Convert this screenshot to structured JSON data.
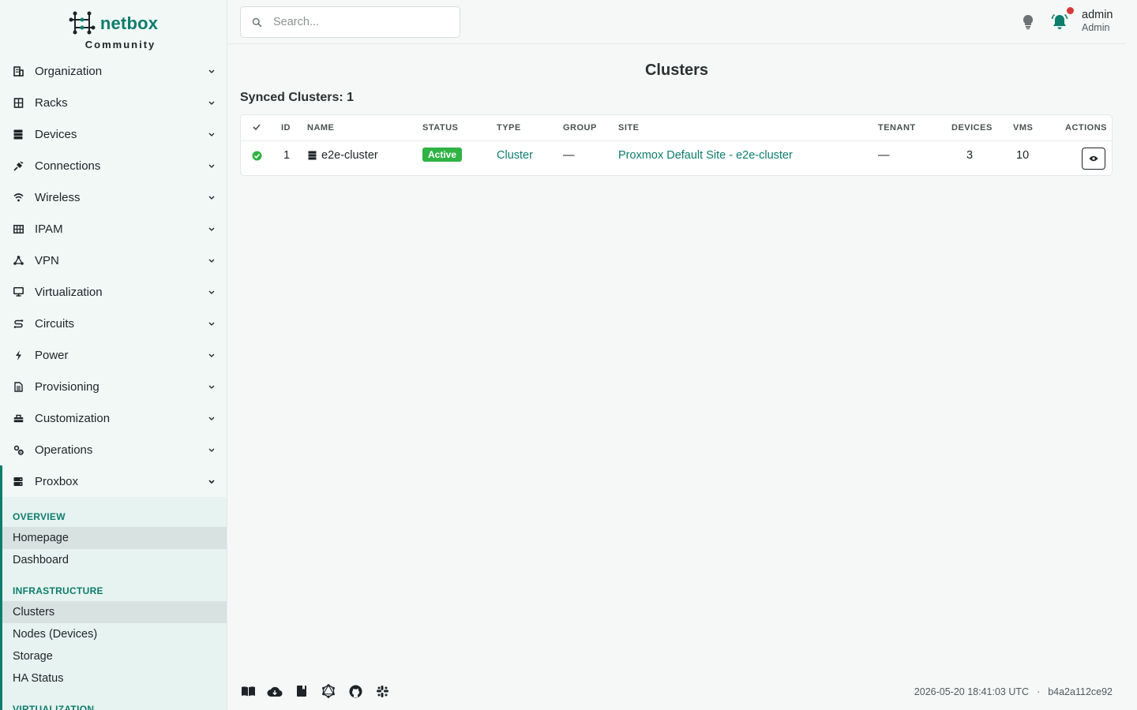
{
  "brand": {
    "name": "netbox",
    "edition": "Community"
  },
  "search": {
    "placeholder": "Search..."
  },
  "user": {
    "name": "admin",
    "role": "Admin"
  },
  "nav": [
    {
      "label": "Organization",
      "icon": "building-icon"
    },
    {
      "label": "Racks",
      "icon": "rack-icon"
    },
    {
      "label": "Devices",
      "icon": "server-icon"
    },
    {
      "label": "Connections",
      "icon": "plug-icon"
    },
    {
      "label": "Wireless",
      "icon": "wifi-icon"
    },
    {
      "label": "IPAM",
      "icon": "counter-icon"
    },
    {
      "label": "VPN",
      "icon": "network-icon"
    },
    {
      "label": "Virtualization",
      "icon": "monitor-icon"
    },
    {
      "label": "Circuits",
      "icon": "transit-icon"
    },
    {
      "label": "Power",
      "icon": "bolt-icon"
    },
    {
      "label": "Provisioning",
      "icon": "file-icon"
    },
    {
      "label": "Customization",
      "icon": "toolbox-icon"
    },
    {
      "label": "Operations",
      "icon": "cogs-icon"
    },
    {
      "label": "Proxbox",
      "icon": "server-icon"
    }
  ],
  "proxbox": {
    "overview_heading": "OVERVIEW",
    "overview_items": [
      "Homepage",
      "Dashboard"
    ],
    "infrastructure_heading": "INFRASTRUCTURE",
    "infrastructure_items": [
      "Clusters",
      "Nodes (Devices)",
      "Storage",
      "HA Status"
    ],
    "virtualization_heading": "VIRTUALIZATION"
  },
  "page": {
    "title": "Clusters",
    "section": "Synced Clusters: 1"
  },
  "table": {
    "headers": {
      "id": "ID",
      "name": "NAME",
      "status": "STATUS",
      "type": "TYPE",
      "group": "GROUP",
      "site": "SITE",
      "tenant": "TENANT",
      "devices": "DEVICES",
      "vms": "VMS",
      "actions": "ACTIONS"
    },
    "rows": [
      {
        "id": "1",
        "name": "e2e-cluster",
        "status": "Active",
        "type": "Cluster",
        "group": "—",
        "site": "Proxmox Default Site - e2e-cluster",
        "tenant": "—",
        "devices": "3",
        "vms": "10"
      }
    ]
  },
  "footer": {
    "timestamp": "2026-05-20 18:41:03 UTC",
    "separator": "·",
    "commit": "b4a2a112ce92"
  },
  "colors": {
    "accent": "#0d7d6c",
    "success": "#2fb344",
    "notification": "#d63939"
  }
}
